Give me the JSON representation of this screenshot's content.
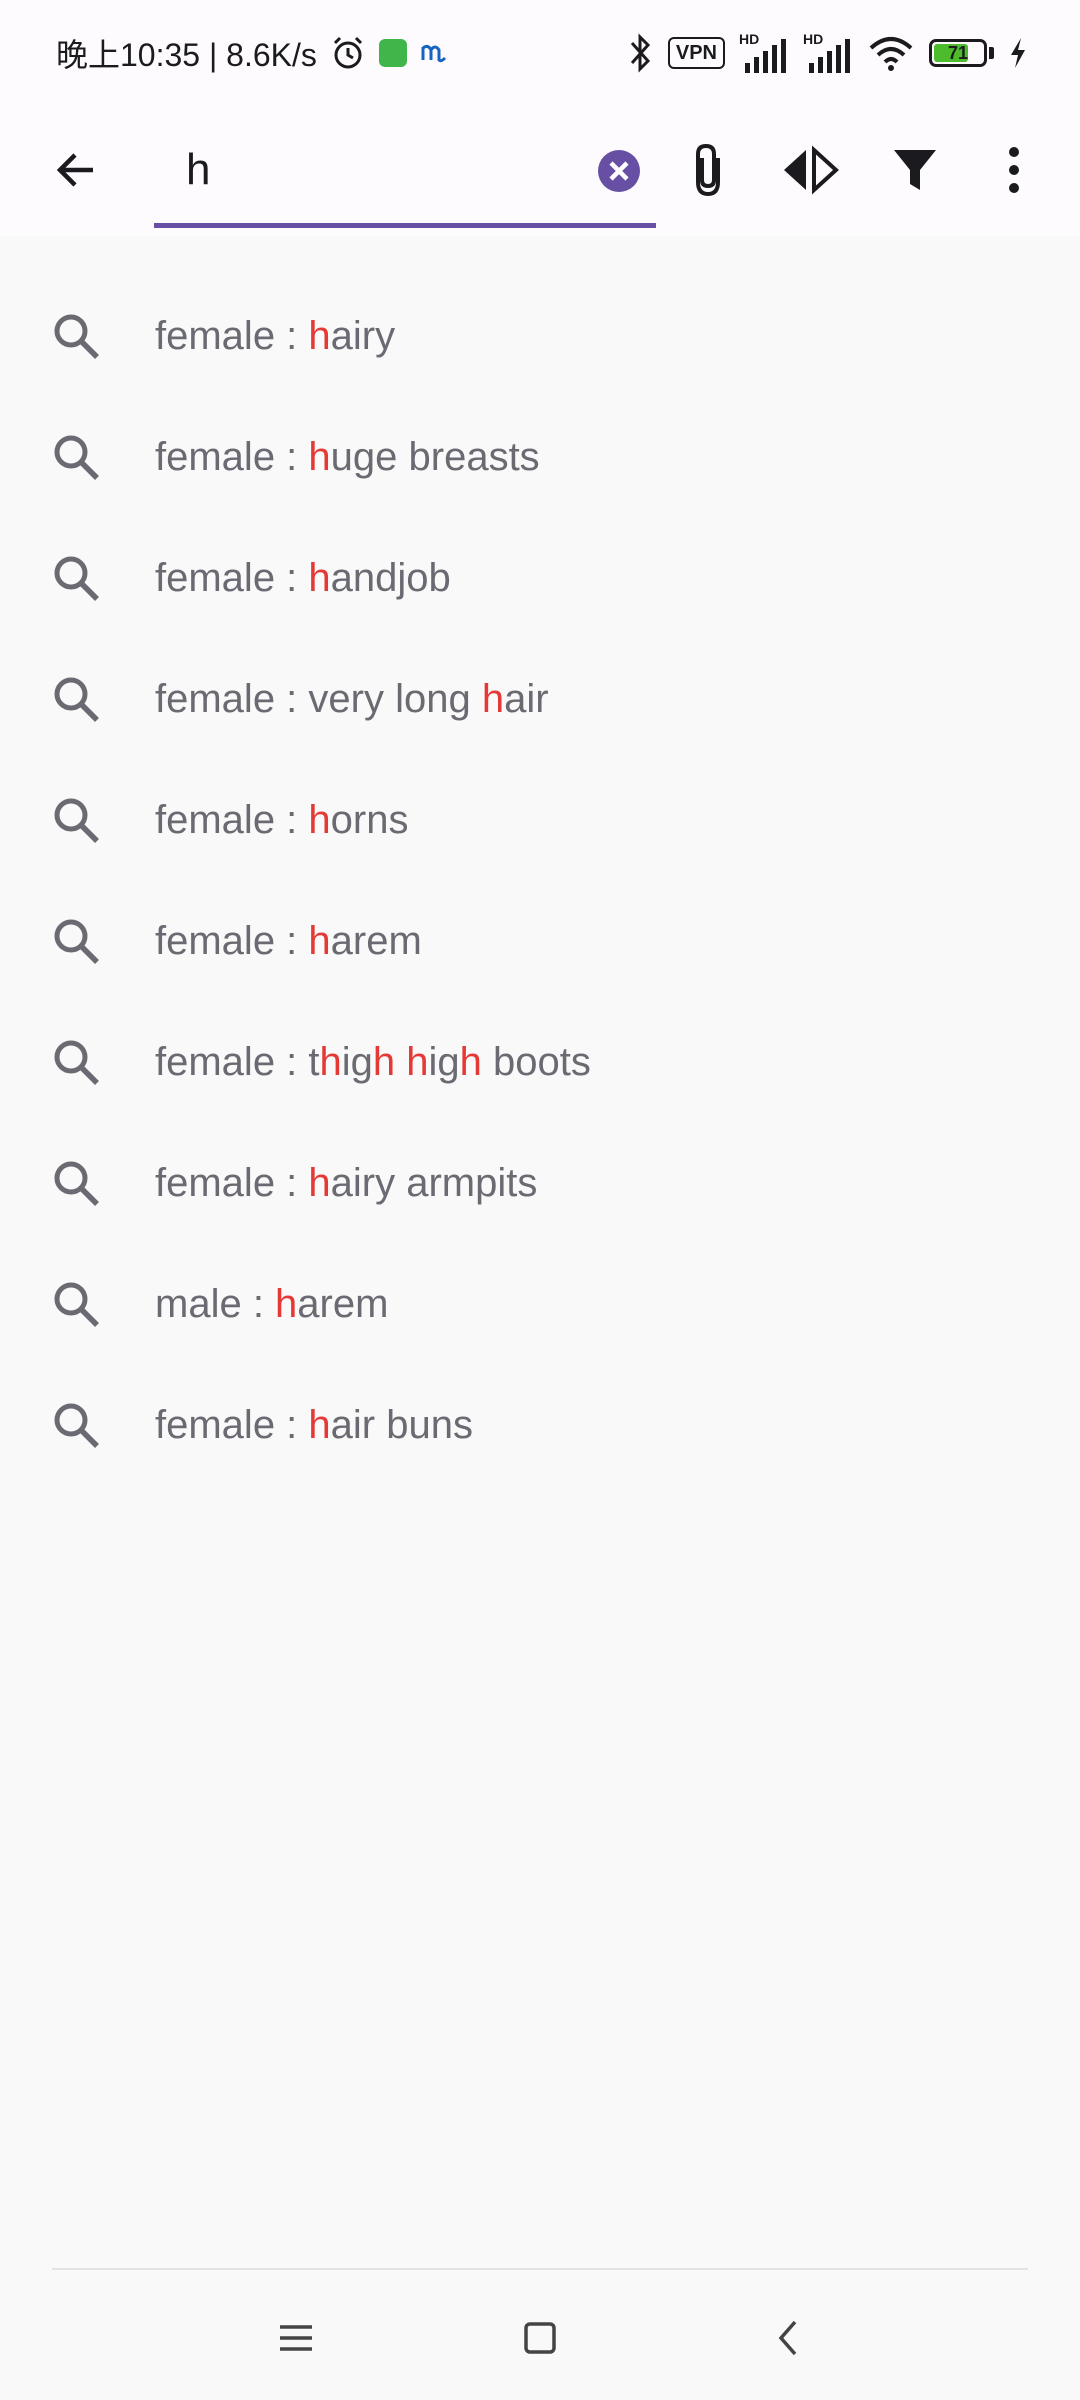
{
  "status_bar": {
    "time": "晚上10:35 | 8.6K/s",
    "vpn_label": "VPN",
    "hd_label_1": "HD",
    "hd_label_2": "HD",
    "battery_level": "71",
    "battery_fill_fraction": 0.71,
    "colors": {
      "battery": "#4cbb2c"
    }
  },
  "search": {
    "query": "h"
  },
  "suggestions": [
    {
      "segments": [
        [
          "female : ",
          false
        ],
        [
          "h",
          true
        ],
        [
          "airy",
          false
        ]
      ]
    },
    {
      "segments": [
        [
          "female : ",
          false
        ],
        [
          "h",
          true
        ],
        [
          "uge breasts",
          false
        ]
      ]
    },
    {
      "segments": [
        [
          "female : ",
          false
        ],
        [
          "h",
          true
        ],
        [
          "andjob",
          false
        ]
      ]
    },
    {
      "segments": [
        [
          "female : very long ",
          false
        ],
        [
          "h",
          true
        ],
        [
          "air",
          false
        ]
      ]
    },
    {
      "segments": [
        [
          "female : ",
          false
        ],
        [
          "h",
          true
        ],
        [
          "orns",
          false
        ]
      ]
    },
    {
      "segments": [
        [
          "female : ",
          false
        ],
        [
          "h",
          true
        ],
        [
          "arem",
          false
        ]
      ]
    },
    {
      "segments": [
        [
          "female : t",
          false
        ],
        [
          "h",
          true
        ],
        [
          "ig",
          false
        ],
        [
          "h",
          true
        ],
        [
          " ",
          false
        ],
        [
          "h",
          true
        ],
        [
          "ig",
          false
        ],
        [
          "h",
          true
        ],
        [
          " boots",
          false
        ]
      ]
    },
    {
      "segments": [
        [
          "female : ",
          false
        ],
        [
          "h",
          true
        ],
        [
          "airy armpits",
          false
        ]
      ]
    },
    {
      "segments": [
        [
          "male : ",
          false
        ],
        [
          "h",
          true
        ],
        [
          "arem",
          false
        ]
      ]
    },
    {
      "segments": [
        [
          "female : ",
          false
        ],
        [
          "h",
          true
        ],
        [
          "air buns",
          false
        ]
      ]
    }
  ],
  "icons": {
    "back": "arrow-left-icon",
    "clear": "close-circle-icon",
    "attach": "paperclip-icon",
    "compare": "split-arrows-icon",
    "filter": "funnel-icon",
    "more": "more-vertical-icon",
    "suggestion": "search-icon",
    "nav_menu": "menu-icon",
    "nav_home": "home-square-icon",
    "nav_back": "chevron-left-icon"
  },
  "colors": {
    "accent": "#6750a4",
    "highlight": "#e53935",
    "suggestion_text": "#6b6a72"
  }
}
